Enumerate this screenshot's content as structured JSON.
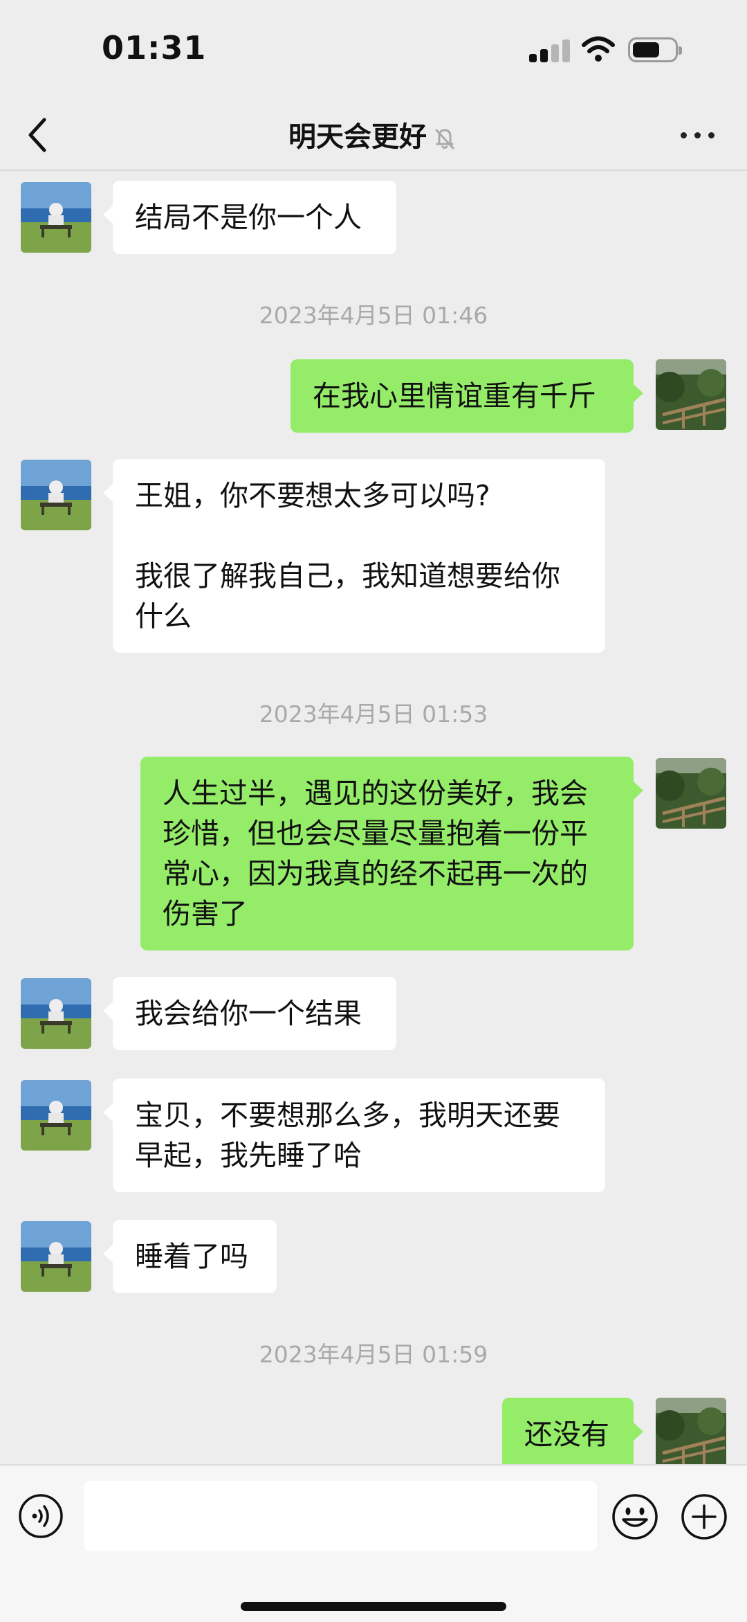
{
  "status_bar": {
    "time": "01:31"
  },
  "nav": {
    "title": "明天会更好"
  },
  "messages": [
    {
      "type": "in",
      "text": "结局不是你一个人"
    },
    {
      "type": "time",
      "text": "2023年4月5日 01:46"
    },
    {
      "type": "out",
      "text": "在我心里情谊重有千斤"
    },
    {
      "type": "in",
      "text": "王姐，你不要想太多可以吗?\n\n我很了解我自己，我知道想要给你什么"
    },
    {
      "type": "time",
      "text": "2023年4月5日 01:53"
    },
    {
      "type": "out",
      "text": "人生过半，遇见的这份美好，我会珍惜，但也会尽量尽量抱着一份平常心，因为我真的经不起再一次的伤害了"
    },
    {
      "type": "in",
      "text": "我会给你一个结果"
    },
    {
      "type": "in",
      "text": "宝贝，不要想那么多，我明天还要早起，我先睡了哈"
    },
    {
      "type": "in",
      "text": "睡着了吗"
    },
    {
      "type": "time",
      "text": "2023年4月5日 01:59"
    },
    {
      "type": "out",
      "text": "还没有"
    }
  ],
  "input": {
    "value": "",
    "placeholder": ""
  },
  "icons": {
    "back": "chevron-left-icon",
    "mute": "bell-slash-icon",
    "more": "more-dots-icon",
    "voice": "voice-icon",
    "emoji": "emoji-icon",
    "plus": "plus-icon"
  },
  "colors": {
    "background": "#ededed",
    "bubble_out": "#95ec69",
    "bubble_in": "#ffffff",
    "timestamp": "#a9a9a9"
  }
}
